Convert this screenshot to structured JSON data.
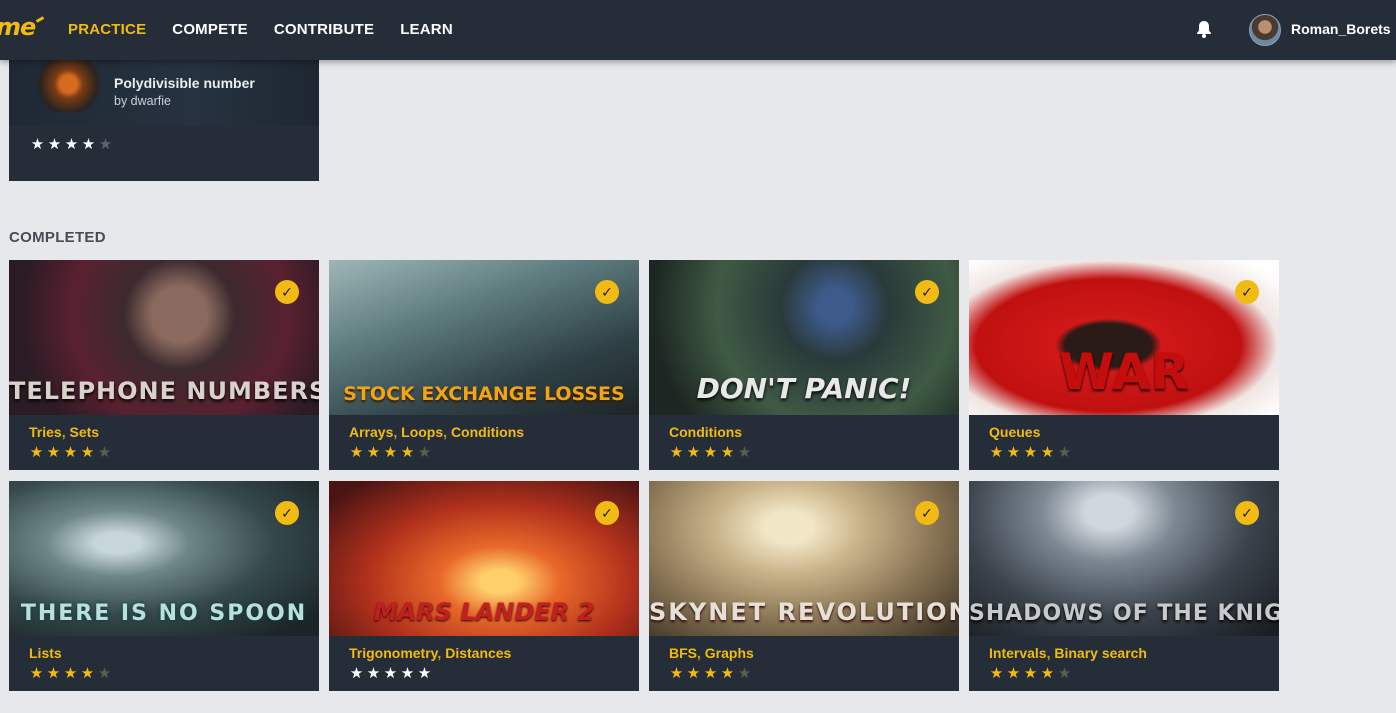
{
  "nav": {
    "logo": "me",
    "items": [
      {
        "label": "PRACTICE",
        "active": true
      },
      {
        "label": "COMPETE",
        "active": false
      },
      {
        "label": "CONTRIBUTE",
        "active": false
      },
      {
        "label": "LEARN",
        "active": false
      }
    ],
    "username": "Roman_Borets"
  },
  "top_card": {
    "title": "Polydivisible number",
    "author": "by dwarfie",
    "rating": 4,
    "rating_max": 5
  },
  "section": {
    "title": "COMPLETED"
  },
  "cards": [
    {
      "art_title": "TELEPHONE NUMBERS",
      "tags": [
        "Tries",
        "Sets"
      ],
      "rating": 4,
      "completed": true
    },
    {
      "art_title": "STOCK EXCHANGE LOSSES",
      "tags": [
        "Arrays",
        "Loops",
        "Conditions"
      ],
      "rating": 4,
      "completed": true
    },
    {
      "art_title": "DON'T PANIC!",
      "tags": [
        "Conditions"
      ],
      "rating": 4,
      "completed": true
    },
    {
      "art_title": "WAR",
      "tags": [
        "Queues"
      ],
      "rating": 4,
      "completed": true
    },
    {
      "art_title": "THERE IS NO SPOON",
      "tags": [
        "Lists"
      ],
      "rating": 4,
      "completed": true
    },
    {
      "art_title": "MARS LANDER 2",
      "tags": [
        "Trigonometry",
        "Distances"
      ],
      "rating": 5,
      "completed": true
    },
    {
      "art_title": "SKYNET REVOLUTION",
      "tags": [
        "BFS",
        "Graphs"
      ],
      "rating": 4,
      "completed": true
    },
    {
      "art_title": "SHADOWS OF THE KNIGHT",
      "tags": [
        "Intervals",
        "Binary search"
      ],
      "rating": 4,
      "completed": true
    }
  ],
  "colors": {
    "accent": "#f2bb13",
    "nav_bg": "#252e38",
    "page_bg": "#e7e8eb"
  },
  "icons": {
    "bell": "bell-icon",
    "check": "check-icon",
    "star": "star-icon"
  }
}
